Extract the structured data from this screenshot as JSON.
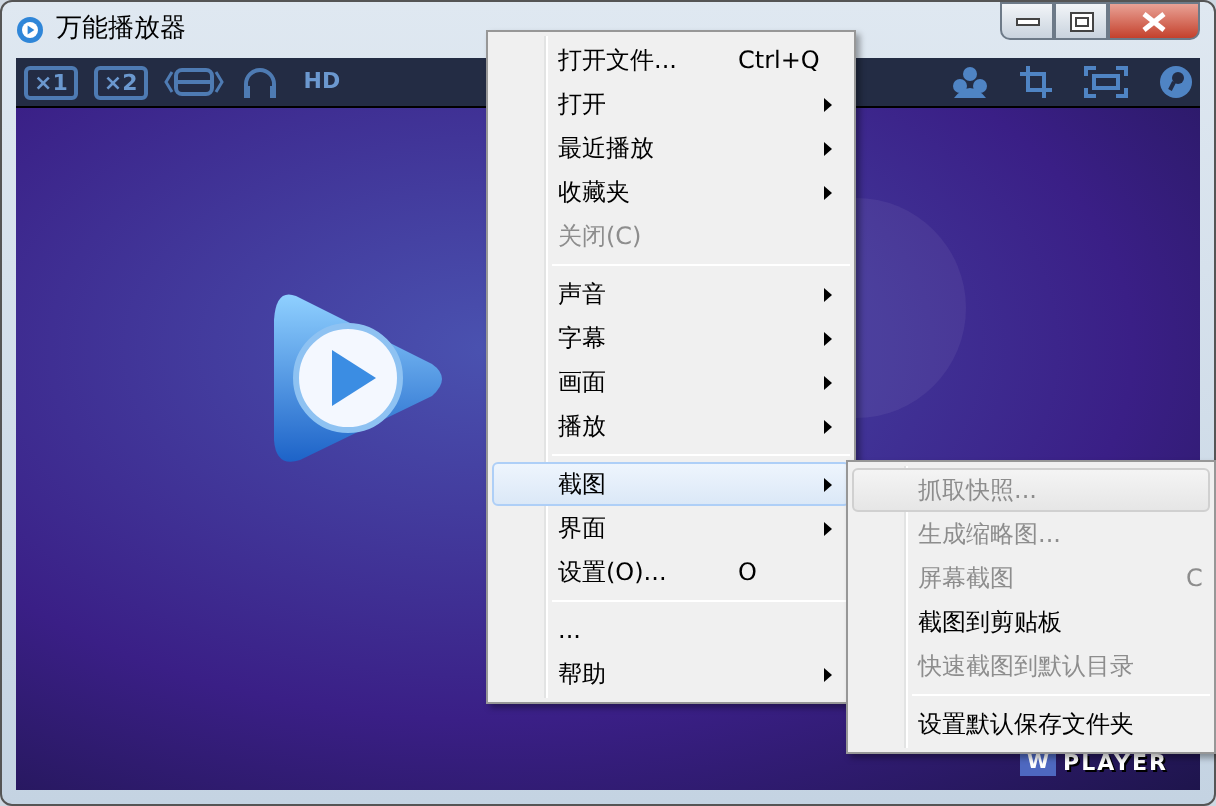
{
  "window": {
    "title": "万能播放器"
  },
  "toolbar": {
    "buttons": [
      {
        "kind": "box",
        "label": "×1"
      },
      {
        "kind": "box",
        "label": "×2"
      },
      {
        "kind": "aspect"
      },
      {
        "kind": "headphones"
      },
      {
        "kind": "text",
        "label": "HD"
      }
    ]
  },
  "menu": {
    "items": [
      {
        "kind": "item",
        "label": "打开文件...",
        "shortcut": "Ctrl+Q",
        "submenu": false,
        "disabled": false,
        "selected": false
      },
      {
        "kind": "item",
        "label": "打开",
        "submenu": true,
        "disabled": false,
        "selected": false
      },
      {
        "kind": "item",
        "label": "最近播放",
        "submenu": true,
        "disabled": false,
        "selected": false
      },
      {
        "kind": "item",
        "label": "收藏夹",
        "submenu": true,
        "disabled": false,
        "selected": false
      },
      {
        "kind": "item",
        "label": "关闭(C)",
        "submenu": false,
        "disabled": true,
        "selected": false
      },
      {
        "kind": "separator"
      },
      {
        "kind": "item",
        "label": "声音",
        "submenu": true,
        "disabled": false,
        "selected": false
      },
      {
        "kind": "item",
        "label": "字幕",
        "submenu": true,
        "disabled": false,
        "selected": false
      },
      {
        "kind": "item",
        "label": "画面",
        "submenu": true,
        "disabled": false,
        "selected": false
      },
      {
        "kind": "item",
        "label": "播放",
        "submenu": true,
        "disabled": false,
        "selected": false
      },
      {
        "kind": "separator"
      },
      {
        "kind": "item",
        "label": "截图",
        "submenu": true,
        "disabled": false,
        "selected": true
      },
      {
        "kind": "item",
        "label": "界面",
        "submenu": true,
        "disabled": false,
        "selected": false
      },
      {
        "kind": "item",
        "label": "设置(O)...",
        "shortcut": "O",
        "submenu": false,
        "disabled": false,
        "selected": false
      },
      {
        "kind": "separator"
      },
      {
        "kind": "item",
        "label": "...",
        "submenu": false,
        "disabled": false,
        "selected": false
      },
      {
        "kind": "item",
        "label": "帮助",
        "submenu": true,
        "disabled": false,
        "selected": false
      }
    ]
  },
  "submenu": {
    "items": [
      {
        "kind": "item",
        "label": "抓取快照...",
        "submenu": false,
        "disabled": true,
        "selected": true
      },
      {
        "kind": "item",
        "label": "生成缩略图...",
        "submenu": false,
        "disabled": true,
        "selected": false
      },
      {
        "kind": "item",
        "label": "屏幕截图",
        "shortcut": "C",
        "submenu": false,
        "disabled": true,
        "selected": false
      },
      {
        "kind": "item",
        "label": "截图到剪贴板",
        "submenu": false,
        "disabled": false,
        "selected": false
      },
      {
        "kind": "item",
        "label": "快速截图到默认目录",
        "submenu": false,
        "disabled": true,
        "selected": false
      },
      {
        "kind": "separator"
      },
      {
        "kind": "item",
        "label": "设置默认保存文件夹",
        "submenu": false,
        "disabled": false,
        "selected": false
      }
    ]
  },
  "brand": {
    "badge": "W",
    "text": "PLAYER"
  }
}
